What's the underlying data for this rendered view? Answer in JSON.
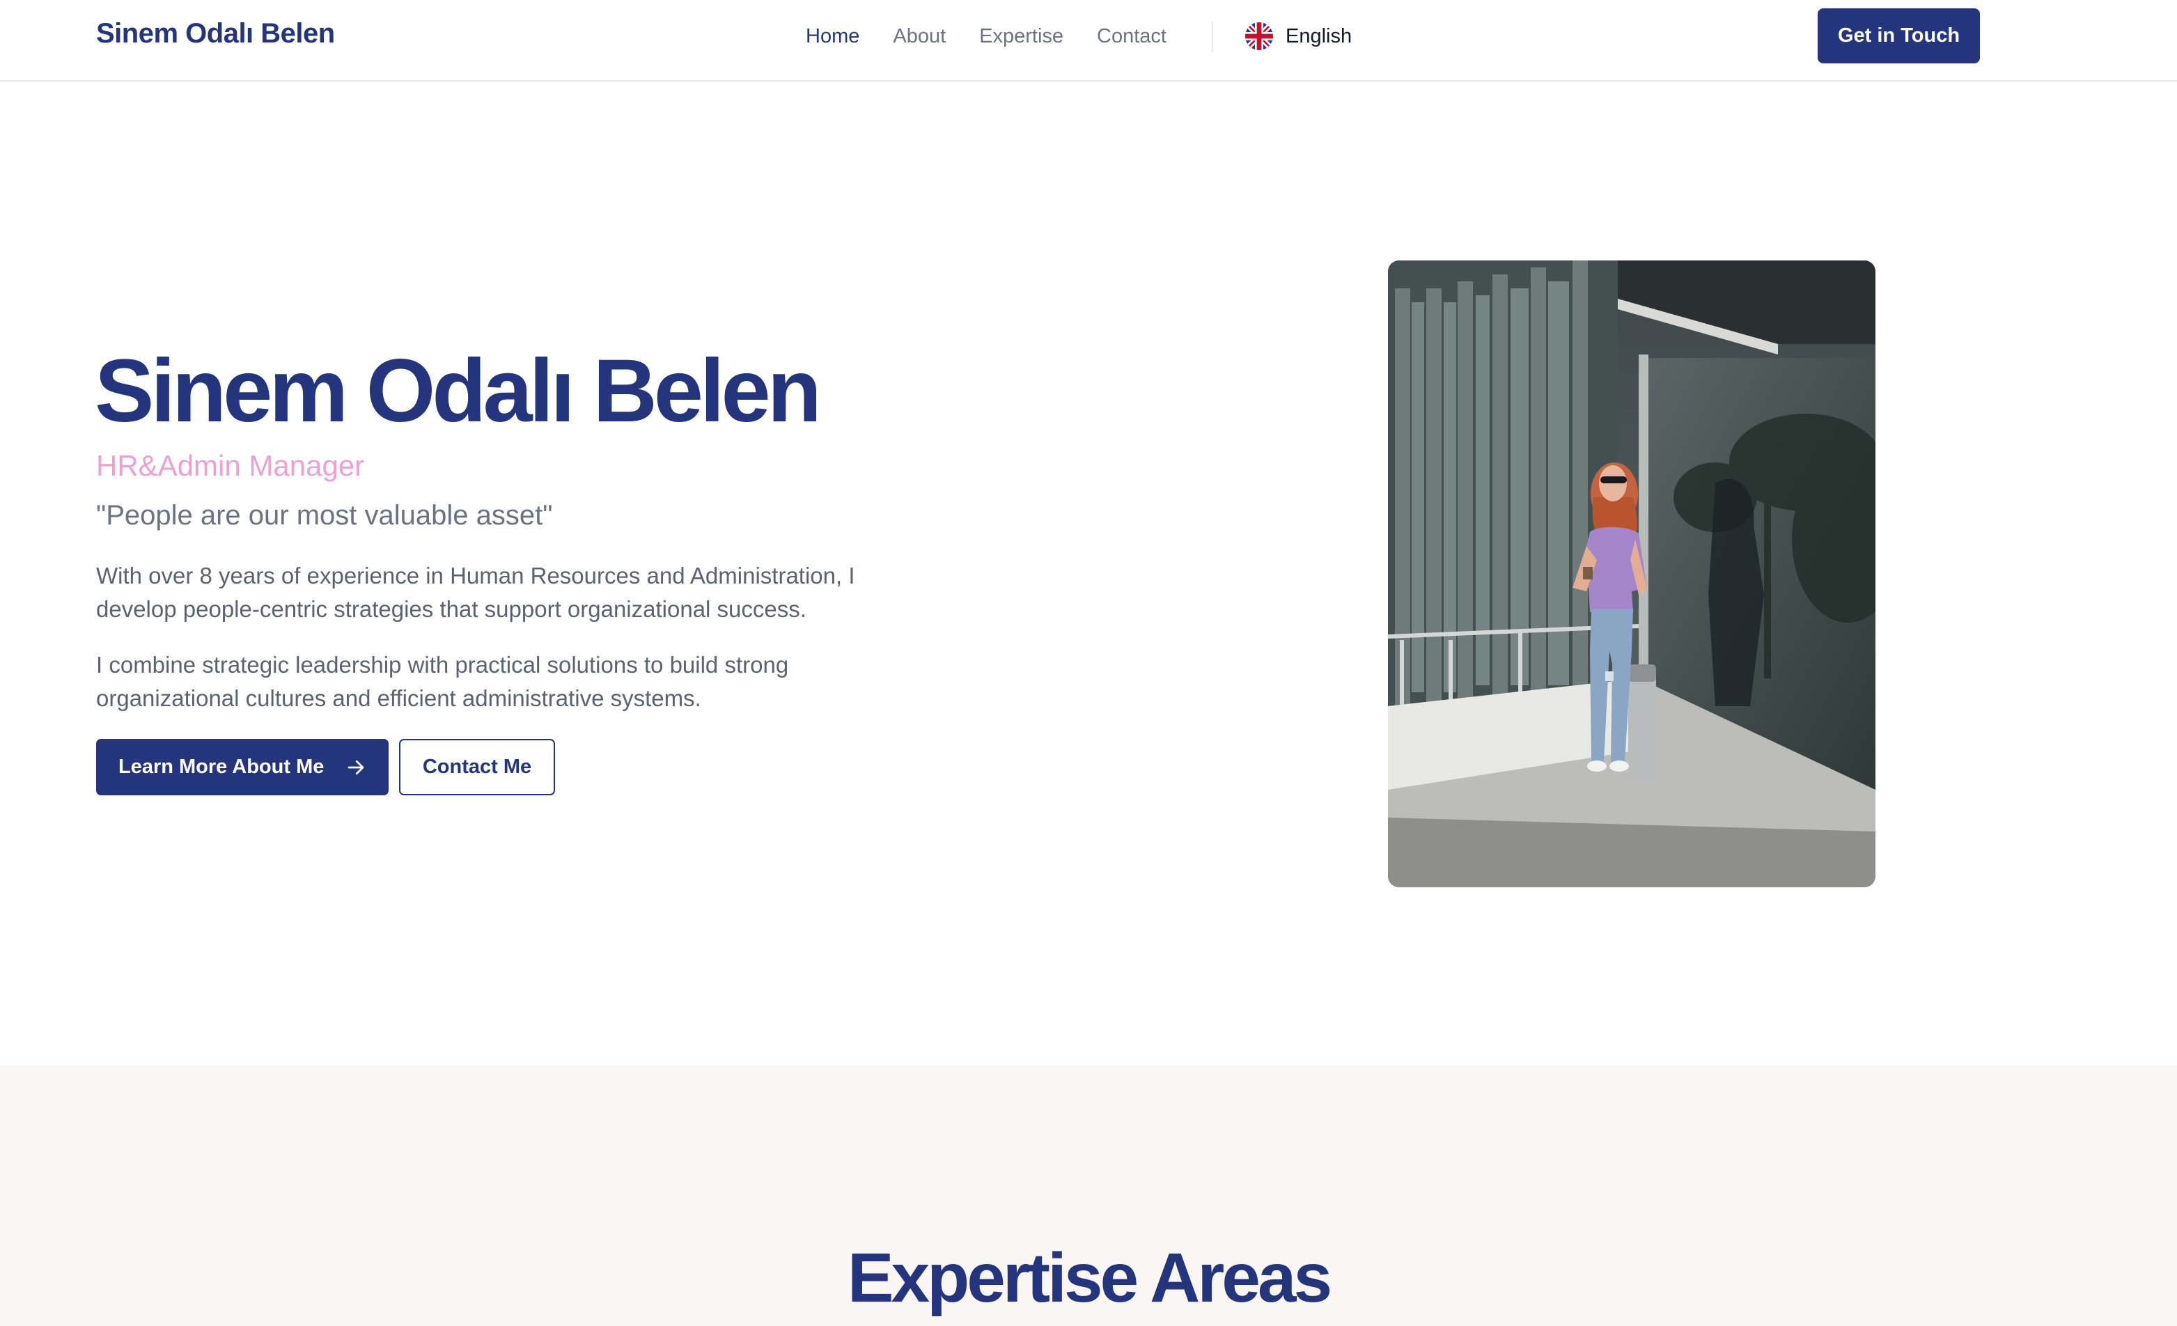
{
  "header": {
    "brand": "Sinem Odalı Belen",
    "nav": [
      {
        "label": "Home",
        "active": true
      },
      {
        "label": "About",
        "active": false
      },
      {
        "label": "Expertise",
        "active": false
      },
      {
        "label": "Contact",
        "active": false
      }
    ],
    "language": {
      "label": "English",
      "icon": "uk-flag-icon"
    },
    "cta_label": "Get in Touch"
  },
  "hero": {
    "name": "Sinem Odalı Belen",
    "role": "HR&Admin Manager",
    "quote": "\"People are our most valuable asset\"",
    "paragraph_1": "With over 8 years of experience in Human Resources and Administration, I develop people-centric strategies that support organizational success.",
    "paragraph_2": "I combine strategic leadership with practical solutions to build strong organizational cultures and efficient administrative systems.",
    "primary_button": "Learn More About Me",
    "primary_button_icon": "arrow-right-icon",
    "secondary_button": "Contact Me",
    "photo_icon": "profile-photo"
  },
  "expertise": {
    "title": "Expertise Areas"
  },
  "colors": {
    "brand": "#24357d",
    "role_accent": "#eaa2d2",
    "body_text": "#5b6270",
    "band_background": "#faf6f3"
  }
}
